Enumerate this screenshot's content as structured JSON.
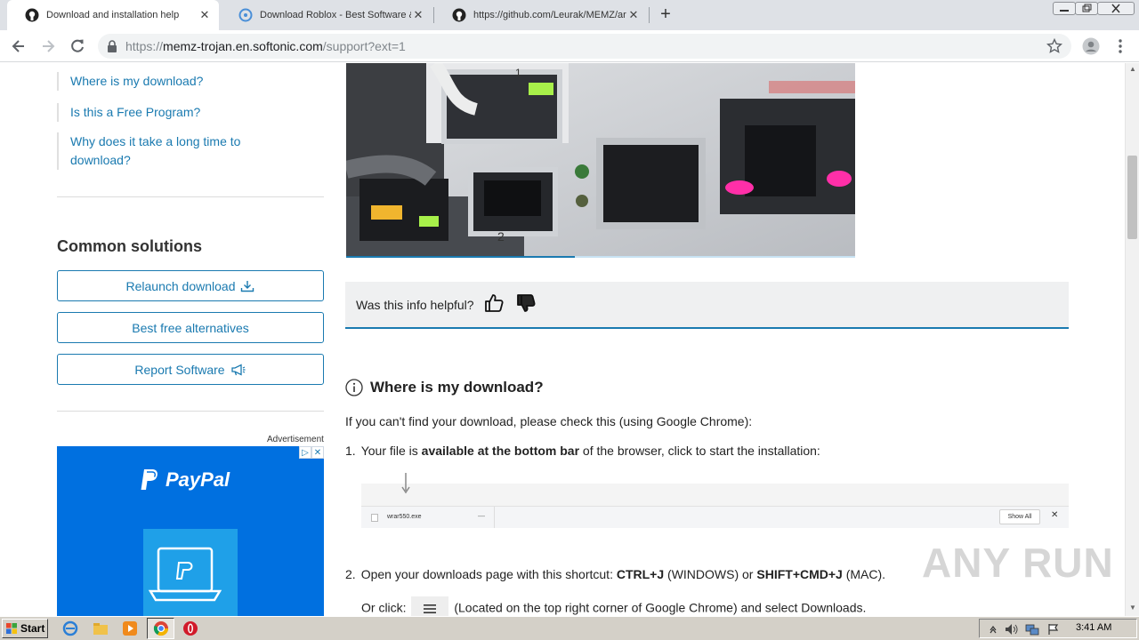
{
  "browser": {
    "tabs": [
      {
        "title": "Download and installation help",
        "active": true,
        "icon": "github-icon"
      },
      {
        "title": "Download Roblox - Best Software &",
        "active": false,
        "icon": "softonic-icon"
      },
      {
        "title": "https://github.com/Leurak/MEMZ/ar",
        "active": false,
        "icon": "github-icon"
      }
    ],
    "address": {
      "prefix": "https://",
      "host": "memz-trojan.en.softonic.com",
      "path": "/support?ext=1"
    }
  },
  "sidebar": {
    "links": [
      "Where is my download?",
      "Is this a Free Program?",
      "Why does it take a long time to download?"
    ],
    "common_solutions_title": "Common solutions",
    "buttons": {
      "relaunch": "Relaunch download",
      "alternatives": "Best free alternatives",
      "report": "Report Software"
    },
    "ad_label": "Advertisement",
    "ad_brand": "PayPal"
  },
  "main": {
    "video_progress": 0.45,
    "helpful_question": "Was this info helpful?",
    "section_title": "Where is my download?",
    "intro": "If you can't find your download, please check this (using Google Chrome):",
    "step1": {
      "num": "1.",
      "pre": "Your file is ",
      "bold": "available at the bottom bar",
      "post": " of the browser, click to start the installation:"
    },
    "download_bar": {
      "filename": "wrar550.exe",
      "show_all": "Show All"
    },
    "step2": {
      "num": "2.",
      "pre": "Open your downloads page with this shortcut: ",
      "key1": "CTRL+J",
      "mid": " (WINDOWS) or ",
      "key2": "SHIFT+CMD+J",
      "post": " (MAC)."
    },
    "step2b": {
      "pre": "Or click: ",
      "post": " (Located on the top right corner of Google Chrome) and select Downloads."
    }
  },
  "watermark": "ANY RUN",
  "taskbar": {
    "start_label": "Start",
    "clock": "3:41 AM"
  },
  "colors": {
    "accent": "#1a7ab0",
    "paypal_blue": "#0070e0"
  }
}
